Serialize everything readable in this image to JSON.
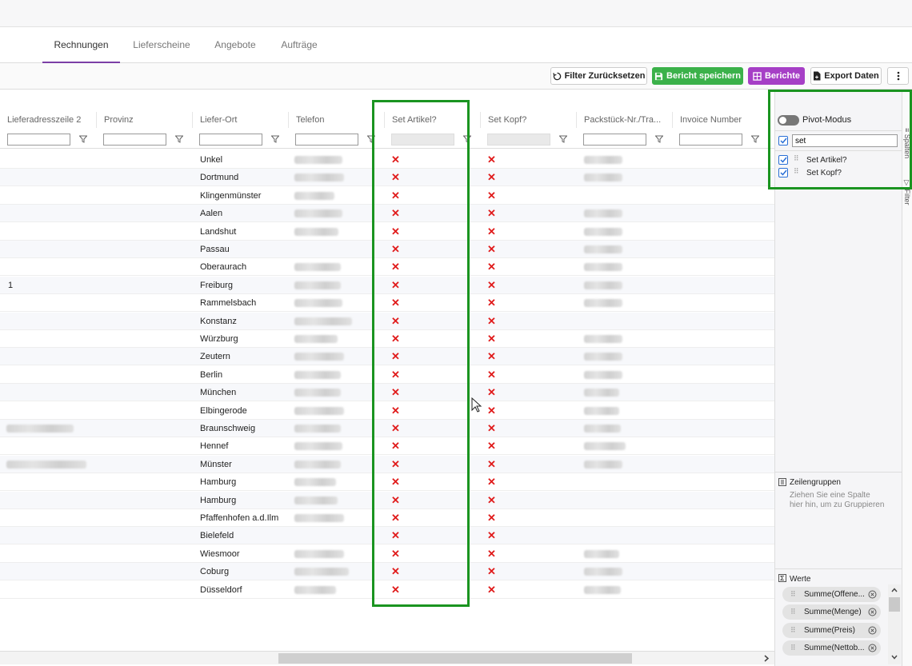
{
  "tabs": [
    {
      "label": "Rechnungen",
      "active": true
    },
    {
      "label": "Lieferscheine",
      "active": false
    },
    {
      "label": "Angebote",
      "active": false
    },
    {
      "label": "Aufträge",
      "active": false
    }
  ],
  "toolbar": {
    "reset_label": "Filter Zurücksetzen",
    "save_label": "Bericht speichern",
    "reports_label": "Berichte",
    "export_label": "Export Daten",
    "more_icon": "more-vertical-icon"
  },
  "grid": {
    "columns": [
      "Lieferadresszeile 2",
      "Provinz",
      "Liefer-Ort",
      "Telefon",
      "Set Artikel?",
      "Set Kopf?",
      "Packstück-Nr./Tra...",
      "Invoice Number"
    ],
    "false_mark": "✕",
    "rows": [
      {
        "zeile2": "",
        "ort": "Unkel"
      },
      {
        "zeile2": "",
        "ort": "Dortmund"
      },
      {
        "zeile2": "",
        "ort": "Klingenmünster"
      },
      {
        "zeile2": "",
        "ort": "Aalen"
      },
      {
        "zeile2": "",
        "ort": "Landshut"
      },
      {
        "zeile2": "",
        "ort": "Passau"
      },
      {
        "zeile2": "",
        "ort": "Oberaurach"
      },
      {
        "zeile2": "1",
        "ort": "Freiburg"
      },
      {
        "zeile2": "",
        "ort": "Rammelsbach"
      },
      {
        "zeile2": "",
        "ort": "Konstanz"
      },
      {
        "zeile2": "",
        "ort": "Würzburg"
      },
      {
        "zeile2": "",
        "ort": "Zeutern"
      },
      {
        "zeile2": "",
        "ort": "Berlin"
      },
      {
        "zeile2": "",
        "ort": "München"
      },
      {
        "zeile2": "",
        "ort": "Elbingerode"
      },
      {
        "zeile2": "",
        "ort": "Braunschweig"
      },
      {
        "zeile2": "",
        "ort": "Hennef"
      },
      {
        "zeile2": "",
        "ort": "Münster"
      },
      {
        "zeile2": "",
        "ort": "Hamburg"
      },
      {
        "zeile2": "",
        "ort": "Hamburg"
      },
      {
        "zeile2": "",
        "ort": "Pfaffenhofen a.d.Ilm"
      },
      {
        "zeile2": "",
        "ort": "Bielefeld"
      },
      {
        "zeile2": "",
        "ort": "Wiesmoor"
      },
      {
        "zeile2": "",
        "ort": "Coburg"
      },
      {
        "zeile2": "",
        "ort": "Düsseldorf"
      }
    ]
  },
  "sidepanel": {
    "pivot_label": "Pivot-Modus",
    "search_value": "set",
    "columns": [
      {
        "label": "Set Artikel?",
        "checked": true
      },
      {
        "label": "Set Kopf?",
        "checked": true
      }
    ],
    "row_groups_title": "Zeilengruppen",
    "row_groups_hint": "Ziehen Sie eine Spalte hier hin, um zu Gruppieren",
    "values_title": "Werte",
    "values": [
      "Summe(Offene...",
      "Summe(Menge)",
      "Summe(Preis)",
      "Summe(Nettob..."
    ],
    "vtab_columns": "Spalten",
    "vtab_filter": "Filter"
  }
}
